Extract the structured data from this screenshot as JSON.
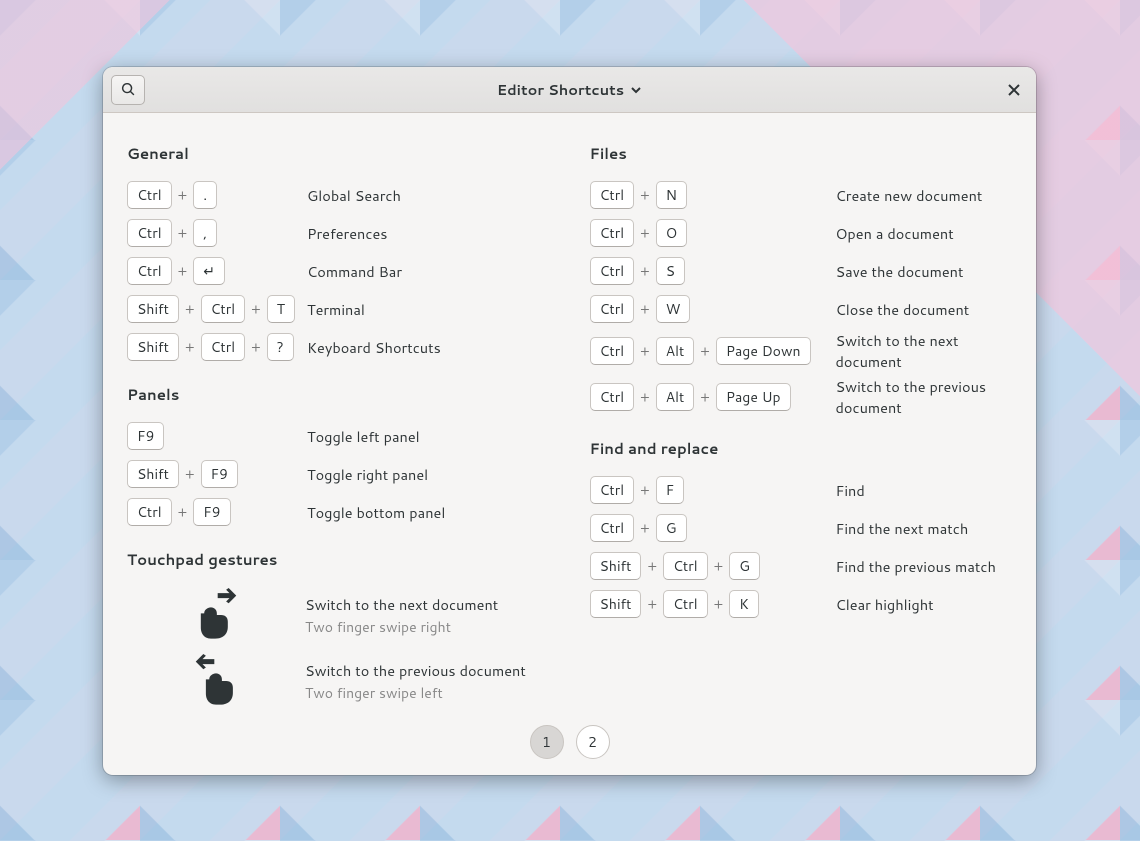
{
  "dialog": {
    "title": "Editor Shortcuts"
  },
  "pager": {
    "page1": "1",
    "page2": "2"
  },
  "left": {
    "general": {
      "title": "General",
      "rows": [
        {
          "keys": [
            "Ctrl",
            "."
          ],
          "desc": "Global Search"
        },
        {
          "keys": [
            "Ctrl",
            ","
          ],
          "desc": "Preferences"
        },
        {
          "keys": [
            "Ctrl",
            "↵"
          ],
          "desc": "Command Bar"
        },
        {
          "keys": [
            "Shift",
            "Ctrl",
            "T"
          ],
          "desc": "Terminal"
        },
        {
          "keys": [
            "Shift",
            "Ctrl",
            "?"
          ],
          "desc": "Keyboard Shortcuts"
        }
      ]
    },
    "panels": {
      "title": "Panels",
      "rows": [
        {
          "keys": [
            "F9"
          ],
          "desc": "Toggle left panel"
        },
        {
          "keys": [
            "Shift",
            "F9"
          ],
          "desc": "Toggle right panel"
        },
        {
          "keys": [
            "Ctrl",
            "F9"
          ],
          "desc": "Toggle bottom panel"
        }
      ]
    },
    "gestures": {
      "title": "Touchpad gestures",
      "rows": [
        {
          "dir": "right",
          "desc": "Switch to the next document",
          "sub": "Two finger swipe right"
        },
        {
          "dir": "left",
          "desc": "Switch to the previous document",
          "sub": "Two finger swipe left"
        }
      ]
    }
  },
  "right": {
    "files": {
      "title": "Files",
      "rows": [
        {
          "keys": [
            "Ctrl",
            "N"
          ],
          "desc": "Create new document"
        },
        {
          "keys": [
            "Ctrl",
            "O"
          ],
          "desc": "Open a document"
        },
        {
          "keys": [
            "Ctrl",
            "S"
          ],
          "desc": "Save the document"
        },
        {
          "keys": [
            "Ctrl",
            "W"
          ],
          "desc": "Close the document"
        },
        {
          "keys": [
            "Ctrl",
            "Alt",
            "Page Down"
          ],
          "desc": "Switch to the next document"
        },
        {
          "keys": [
            "Ctrl",
            "Alt",
            "Page Up"
          ],
          "desc": "Switch to the previous document"
        }
      ]
    },
    "find": {
      "title": "Find and replace",
      "rows": [
        {
          "keys": [
            "Ctrl",
            "F"
          ],
          "desc": "Find"
        },
        {
          "keys": [
            "Ctrl",
            "G"
          ],
          "desc": "Find the next match"
        },
        {
          "keys": [
            "Shift",
            "Ctrl",
            "G"
          ],
          "desc": "Find the previous match"
        },
        {
          "keys": [
            "Shift",
            "Ctrl",
            "K"
          ],
          "desc": "Clear highlight"
        }
      ]
    }
  }
}
